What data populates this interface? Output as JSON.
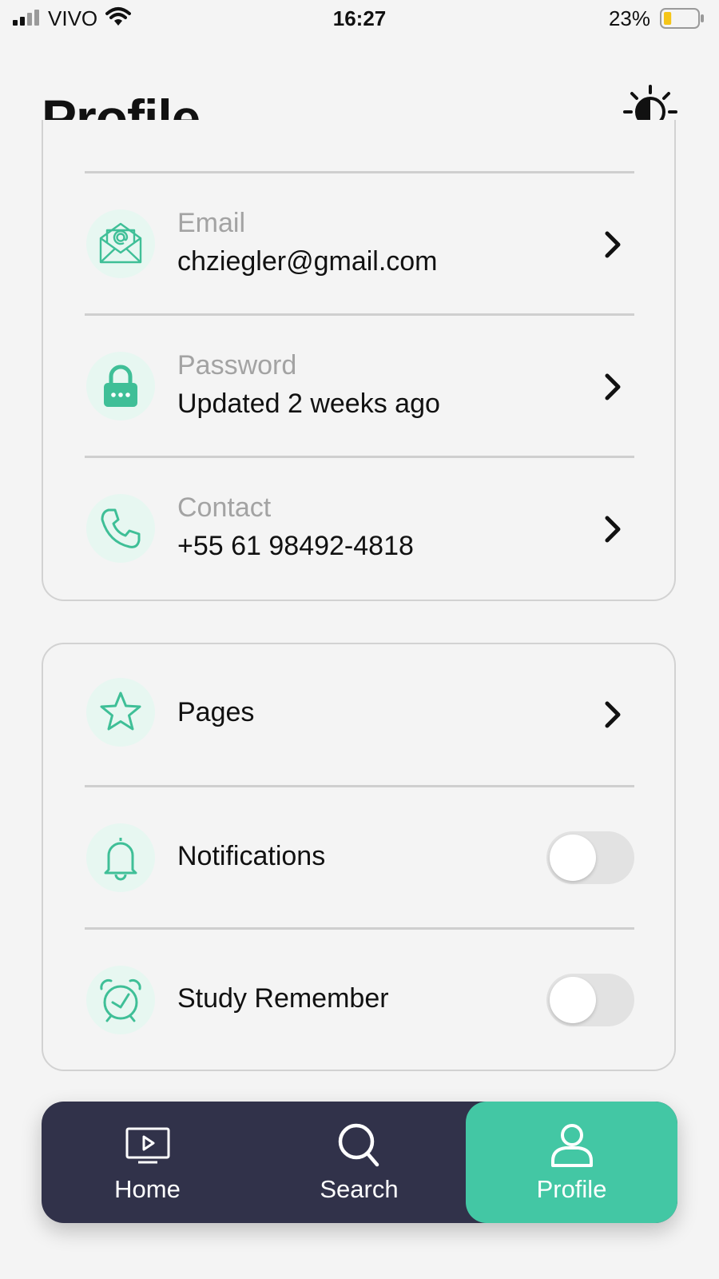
{
  "status_bar": {
    "carrier": "VIVO",
    "time": "16:27",
    "battery_percent": "23%",
    "battery_level": 0.23,
    "signal_icon": "cellular-signal-icon",
    "wifi_icon": "wifi-icon"
  },
  "header": {
    "title": "Profile",
    "theme_icon": "brightness-contrast-icon"
  },
  "account_card": {
    "rows": [
      {
        "label": "Email",
        "value": "chziegler@gmail.com",
        "icon": "envelope-at-icon"
      },
      {
        "label": "Password",
        "value": "Updated 2 weeks ago",
        "icon": "lock-icon"
      },
      {
        "label": "Contact",
        "value": "+55 61 98492-4818",
        "icon": "phone-icon"
      }
    ]
  },
  "settings_card": {
    "pages": {
      "label": "Pages",
      "icon": "star-icon"
    },
    "notifications": {
      "label": "Notifications",
      "icon": "bell-icon",
      "enabled": false
    },
    "study_remember": {
      "label": "Study Remember",
      "icon": "alarm-clock-icon",
      "enabled": false
    }
  },
  "tab_bar": {
    "tabs": [
      {
        "label": "Home",
        "icon": "tv-play-icon",
        "active": false
      },
      {
        "label": "Search",
        "icon": "search-icon",
        "active": false
      },
      {
        "label": "Profile",
        "icon": "user-icon",
        "active": true
      }
    ]
  },
  "colors": {
    "accent": "#43c7a4",
    "icon_green": "#3fbf97",
    "icon_bg": "#e7f7f1",
    "tab_bar_bg": "#31324a",
    "page_bg": "#f4f4f4",
    "muted_text": "#a3a3a3",
    "battery_fill": "#f5c518"
  }
}
